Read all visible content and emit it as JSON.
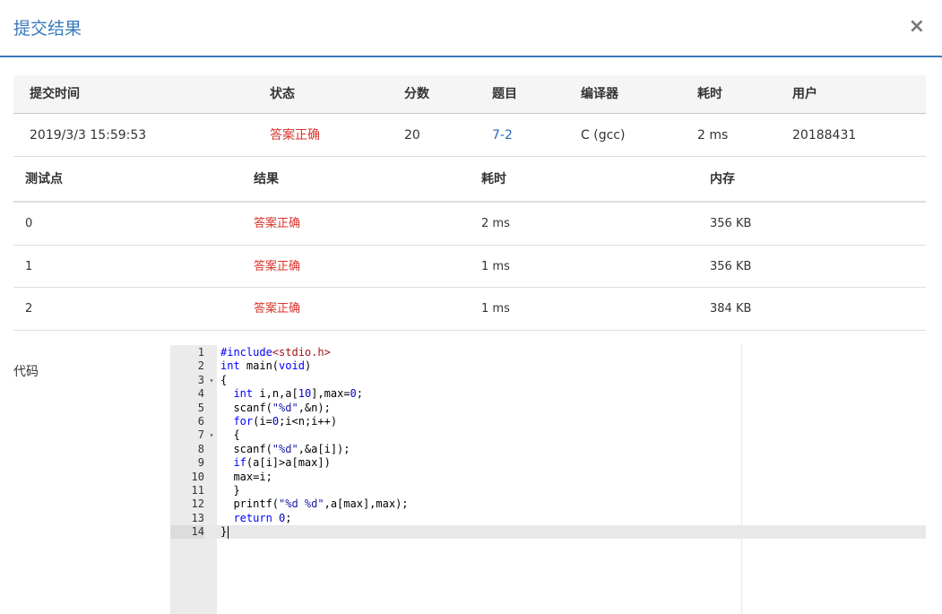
{
  "dialog": {
    "title": "提交结果",
    "close_glyph": "×"
  },
  "summary": {
    "headers": [
      "提交时间",
      "状态",
      "分数",
      "题目",
      "编译器",
      "耗时",
      "用户"
    ],
    "row": {
      "time": "2019/3/3 15:59:53",
      "status": "答案正确",
      "score": "20",
      "problem": "7-2",
      "compiler": "C (gcc)",
      "elapsed": "2 ms",
      "user": "20188431"
    }
  },
  "cases": {
    "headers": [
      "测试点",
      "结果",
      "耗时",
      "内存"
    ],
    "rows": [
      {
        "id": "0",
        "result": "答案正确",
        "time": "2 ms",
        "memory": "356 KB"
      },
      {
        "id": "1",
        "result": "答案正确",
        "time": "1 ms",
        "memory": "356 KB"
      },
      {
        "id": "2",
        "result": "答案正确",
        "time": "1 ms",
        "memory": "384 KB"
      }
    ]
  },
  "code": {
    "label": "代码",
    "lines": [
      "#include<stdio.h>",
      "int main(void)",
      "{",
      "  int i,n,a[10],max=0;",
      "  scanf(\"%d\",&n);",
      "  for(i=0;i<n;i++)",
      "  {",
      "  scanf(\"%d\",&a[i]);",
      "  if(a[i]>a[max])",
      "  max=i;",
      "  }",
      "  printf(\"%d %d\",a[max],max);",
      "  return 0;",
      "}"
    ],
    "fold_lines": [
      3,
      7
    ],
    "active_line": 14,
    "status_color": "#d9332b",
    "accent_color": "#3a79bd"
  }
}
